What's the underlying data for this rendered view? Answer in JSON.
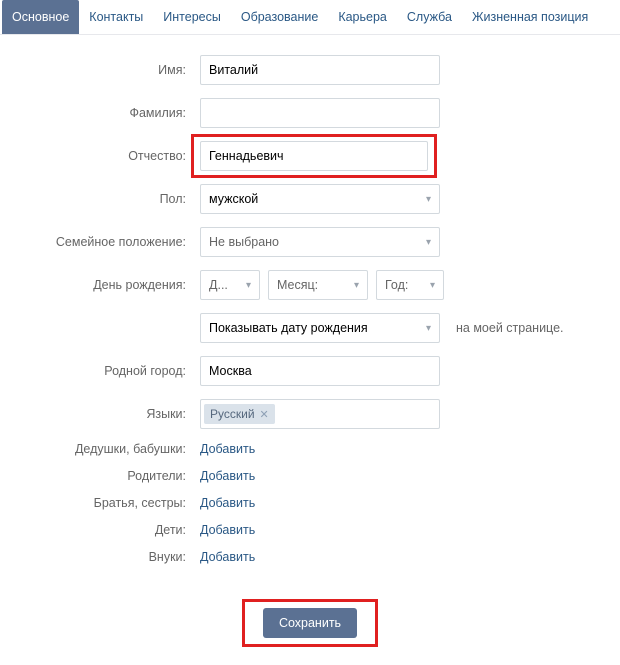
{
  "tabs": {
    "active": "Основное",
    "items": [
      "Основное",
      "Контакты",
      "Интересы",
      "Образование",
      "Карьера",
      "Служба",
      "Жизненная позиция"
    ]
  },
  "form": {
    "name_label": "Имя:",
    "name_value": "Виталий",
    "surname_label": "Фамилия:",
    "surname_value": "",
    "patronymic_label": "Отчество:",
    "patronymic_value": "Геннадьевич",
    "gender_label": "Пол:",
    "gender_value": "мужской",
    "marital_label": "Семейное положение:",
    "marital_value": "Не выбрано",
    "birthday_label": "День рождения:",
    "bday_day": "Д...",
    "bday_month": "Месяц:",
    "bday_year": "Год:",
    "bday_show": "Показывать дату рождения",
    "bday_after": "на моей странице.",
    "hometown_label": "Родной город:",
    "hometown_value": "Москва",
    "languages_label": "Языки:",
    "language_tag": "Русский",
    "grand_label": "Дедушки, бабушки:",
    "parents_label": "Родители:",
    "siblings_label": "Братья, сестры:",
    "children_label": "Дети:",
    "grandchildren_label": "Внуки:",
    "add_link": "Добавить",
    "save_button": "Сохранить"
  }
}
